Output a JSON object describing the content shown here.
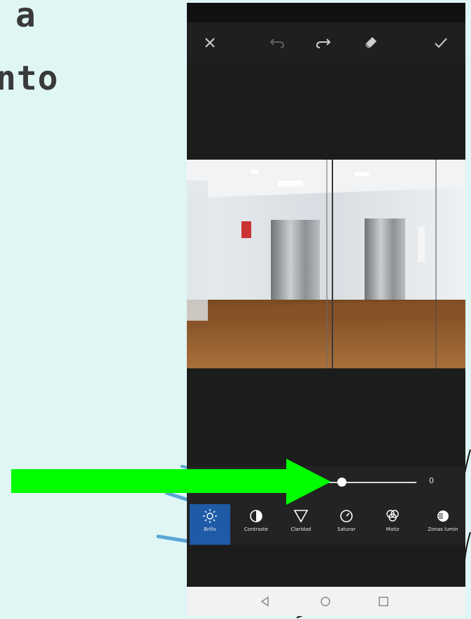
{
  "slide": {
    "line1": "a",
    "line2": "nto"
  },
  "icons": {
    "close": "close-icon",
    "undo": "undo-icon",
    "redo": "redo-icon",
    "eraser": "eraser-icon",
    "confirm": "check-icon"
  },
  "slider": {
    "value": "0",
    "level": 0.5
  },
  "tools": [
    {
      "label": "Brillo",
      "icon": "brightness-icon",
      "active": true
    },
    {
      "label": "Contraste",
      "icon": "contrast-icon",
      "active": false
    },
    {
      "label": "Claridad",
      "icon": "clarity-icon",
      "active": false
    },
    {
      "label": "Saturar",
      "icon": "saturation-icon",
      "active": false
    },
    {
      "label": "Matiz",
      "icon": "hue-icon",
      "active": false
    },
    {
      "label": "Zonas lumin",
      "icon": "highlights-icon",
      "active": false
    }
  ],
  "colors": {
    "slide_bg": "#dff6f4",
    "active_tool": "#1f5aa6",
    "arrow": "#00ff00"
  }
}
